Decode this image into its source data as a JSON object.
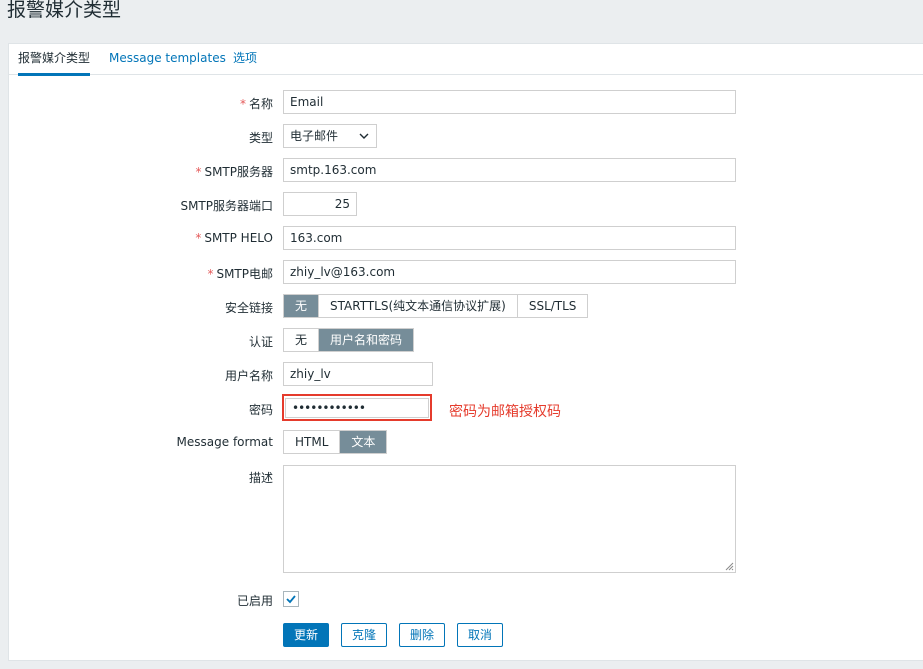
{
  "page": {
    "title": "报警媒介类型"
  },
  "tabs": [
    {
      "label": "报警媒介类型"
    },
    {
      "label": "Message templates"
    },
    {
      "label": "选项"
    }
  ],
  "form": {
    "name": {
      "label": "名称",
      "value": "Email",
      "required": "*"
    },
    "type": {
      "label": "类型",
      "value": "电子邮件"
    },
    "smtp_server": {
      "label": "SMTP服务器",
      "value": "smtp.163.com",
      "required": "*"
    },
    "smtp_port": {
      "label": "SMTP服务器端口",
      "value": "25"
    },
    "smtp_helo": {
      "label": "SMTP HELO",
      "value": "163.com",
      "required": "*"
    },
    "smtp_email": {
      "label": "SMTP电邮",
      "value": "zhiy_lv@163.com",
      "required": "*"
    },
    "security": {
      "label": "安全链接",
      "options": [
        "无",
        "STARTTLS(纯文本通信协议扩展)",
        "SSL/TLS"
      ],
      "selected": "无"
    },
    "auth": {
      "label": "认证",
      "options": [
        "无",
        "用户名和密码"
      ],
      "selected": "用户名和密码"
    },
    "username": {
      "label": "用户名称",
      "value": "zhiy_lv"
    },
    "password": {
      "label": "密码",
      "value": "••••••••••••"
    },
    "message_format": {
      "label": "Message format",
      "options": [
        "HTML",
        "文本"
      ],
      "selected": "文本"
    },
    "description": {
      "label": "描述",
      "value": ""
    },
    "enabled": {
      "label": "已启用",
      "checked": true
    }
  },
  "buttons": {
    "update": "更新",
    "clone": "克隆",
    "delete": "删除",
    "cancel": "取消"
  },
  "annotation": {
    "text": "密码为邮箱授权码"
  },
  "colors": {
    "accent": "#0275b8",
    "segment_active": "#768d99",
    "required": "#e45959",
    "annotation": "#e53b2c"
  }
}
